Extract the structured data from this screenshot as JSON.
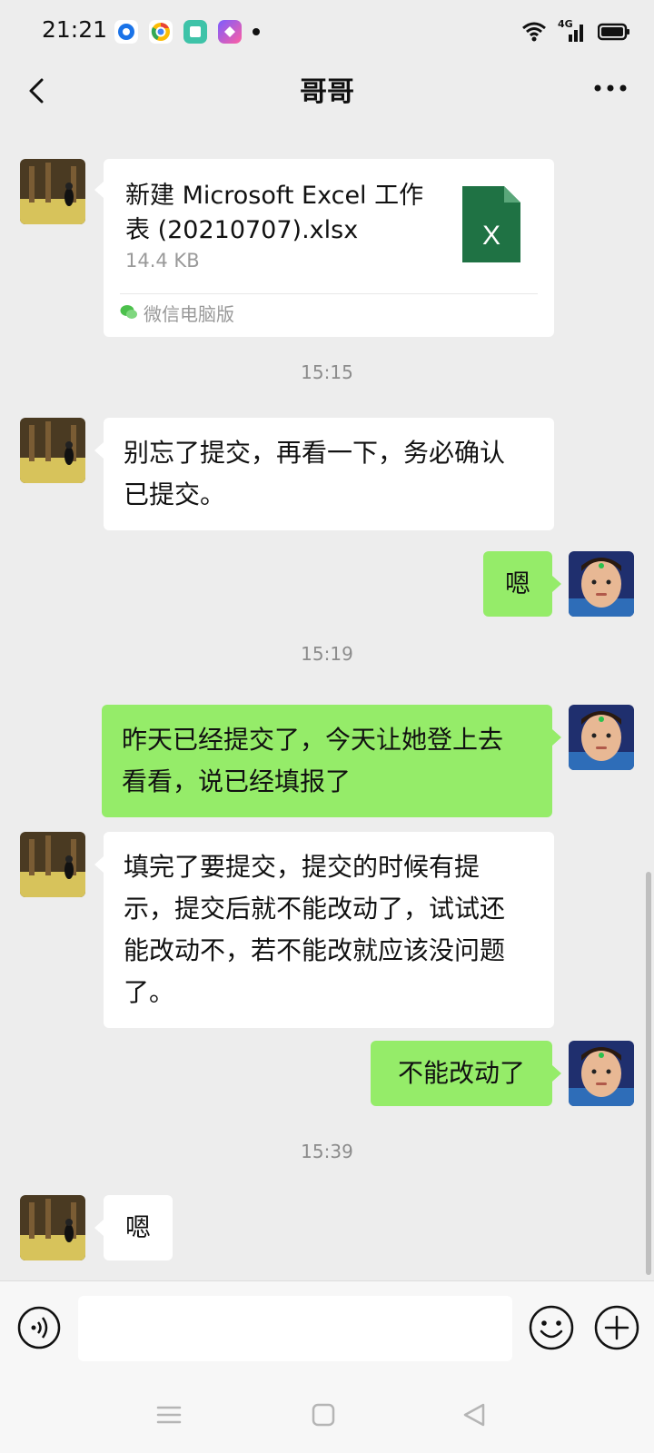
{
  "status_bar": {
    "time": "21:21",
    "network": "4G",
    "icons": [
      "browser-icon",
      "chrome-icon",
      "notes-icon",
      "app-icon",
      "dot-icon",
      "wifi-icon",
      "signal-icon",
      "battery-icon"
    ]
  },
  "header": {
    "title": "哥哥",
    "back_icon": "chevron-left-icon",
    "more_icon": "more-icon"
  },
  "messages": {
    "file": {
      "name": "新建 Microsoft Excel 工作表 (20210707).xlsx",
      "size": "14.4 KB",
      "source": "微信电脑版",
      "icon_letter": "X"
    },
    "time1": "15:15",
    "msg1": [
      "别忘了提交，再看一下，务必确认",
      "已提交。"
    ],
    "msg2": "嗯",
    "time2": "15:19",
    "msg3": [
      "昨天已经提交了，今天让她登上去",
      "看看，说已经填报了"
    ],
    "msg4": [
      "填完了要提交，提交的时候有提",
      "示，提交后就不能改动了，试试还",
      "能改动不，若不能改就应该没问题",
      "了。"
    ],
    "msg5": "不能改动了",
    "time3": "15:39",
    "msg6": "嗯"
  },
  "input_bar": {
    "placeholder": "",
    "voice_icon": "voice-icon",
    "emoji_icon": "emoji-icon",
    "plus_icon": "plus-icon"
  },
  "colors": {
    "background": "#ededed",
    "outgoing_bubble": "#95ec69",
    "incoming_bubble": "#ffffff",
    "excel_green": "#1f7244",
    "timestamp": "#8c8c8c"
  }
}
